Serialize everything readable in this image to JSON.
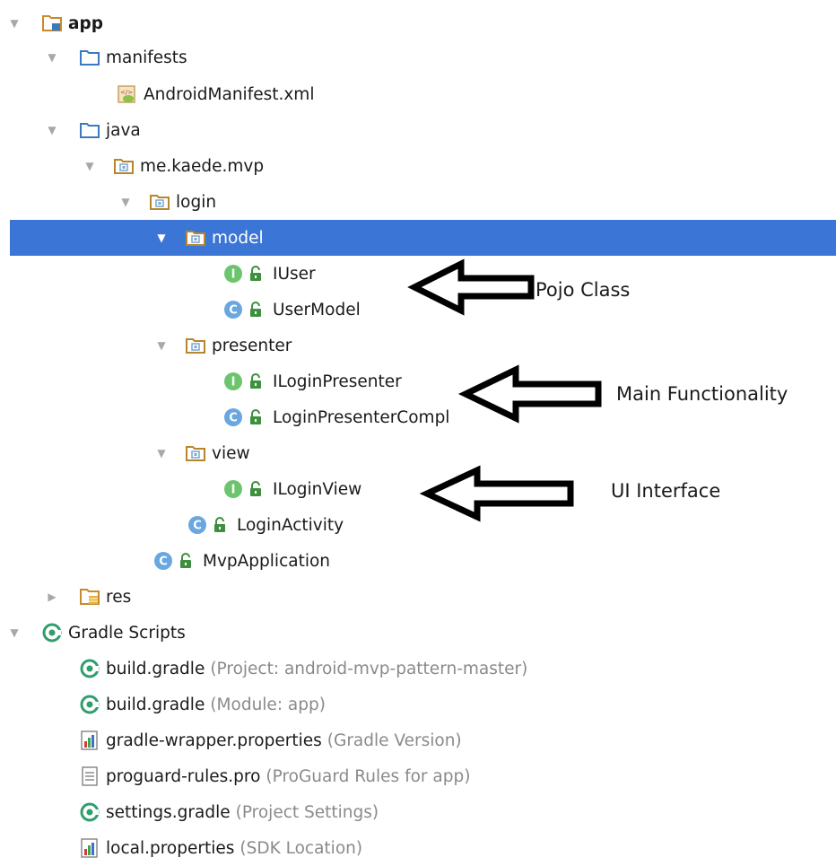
{
  "tree": {
    "rows": [
      {
        "label": "app",
        "toggle": "down",
        "icon": "module-folder-icon",
        "bold": true
      },
      {
        "label": "manifests",
        "toggle": "down",
        "icon": "folder-icon"
      },
      {
        "label": "AndroidManifest.xml",
        "toggle": "none",
        "icon": "xml-manifest-icon"
      },
      {
        "label": "java",
        "toggle": "down",
        "icon": "folder-icon"
      },
      {
        "label": "me.kaede.mvp",
        "toggle": "down",
        "icon": "package-icon"
      },
      {
        "label": "login",
        "toggle": "down",
        "icon": "package-icon"
      },
      {
        "label": "model",
        "toggle": "down",
        "icon": "package-icon",
        "selected": true
      },
      {
        "label": "IUser",
        "toggle": "none",
        "icon": "interface-icon",
        "lock": true
      },
      {
        "label": "UserModel",
        "toggle": "none",
        "icon": "class-icon",
        "lock": true
      },
      {
        "label": "presenter",
        "toggle": "down",
        "icon": "package-icon"
      },
      {
        "label": "ILoginPresenter",
        "toggle": "none",
        "icon": "interface-icon",
        "lock": true
      },
      {
        "label": "LoginPresenterCompl",
        "toggle": "none",
        "icon": "class-icon",
        "lock": true
      },
      {
        "label": "view",
        "toggle": "down",
        "icon": "package-icon"
      },
      {
        "label": "ILoginView",
        "toggle": "none",
        "icon": "interface-icon",
        "lock": true
      },
      {
        "label": "LoginActivity",
        "toggle": "none",
        "icon": "class-icon",
        "lock": true
      },
      {
        "label": "MvpApplication",
        "toggle": "none",
        "icon": "class-icon",
        "lock": true
      },
      {
        "label": "res",
        "toggle": "right",
        "icon": "res-folder-icon"
      },
      {
        "label": "Gradle Scripts",
        "toggle": "down",
        "icon": "gradle-icon"
      },
      {
        "label": "build.gradle",
        "hint": "(Project: android-mvp-pattern-master)",
        "toggle": "none",
        "icon": "gradle-icon"
      },
      {
        "label": "build.gradle",
        "hint": "(Module: app)",
        "toggle": "none",
        "icon": "gradle-icon"
      },
      {
        "label": "gradle-wrapper.properties",
        "hint": "(Gradle Version)",
        "toggle": "none",
        "icon": "properties-icon"
      },
      {
        "label": "proguard-rules.pro",
        "hint": "(ProGuard Rules for app)",
        "toggle": "none",
        "icon": "text-file-icon"
      },
      {
        "label": "settings.gradle",
        "hint": "(Project Settings)",
        "toggle": "none",
        "icon": "gradle-icon"
      },
      {
        "label": "local.properties",
        "hint": "(SDK Location)",
        "toggle": "none",
        "icon": "properties-icon"
      }
    ]
  },
  "annotations": {
    "pojo": "Pojo Class",
    "main": "Main Functionality",
    "ui": "UI Interface"
  },
  "colors": {
    "selection": "#3b75d6",
    "hint": "#8a8a8a",
    "interface_icon": "#6cc56c",
    "class_icon": "#6aa7e0",
    "folder": "#3a7bbf",
    "gradle": "#2f9e6b",
    "lock": "#3e8f3e"
  }
}
